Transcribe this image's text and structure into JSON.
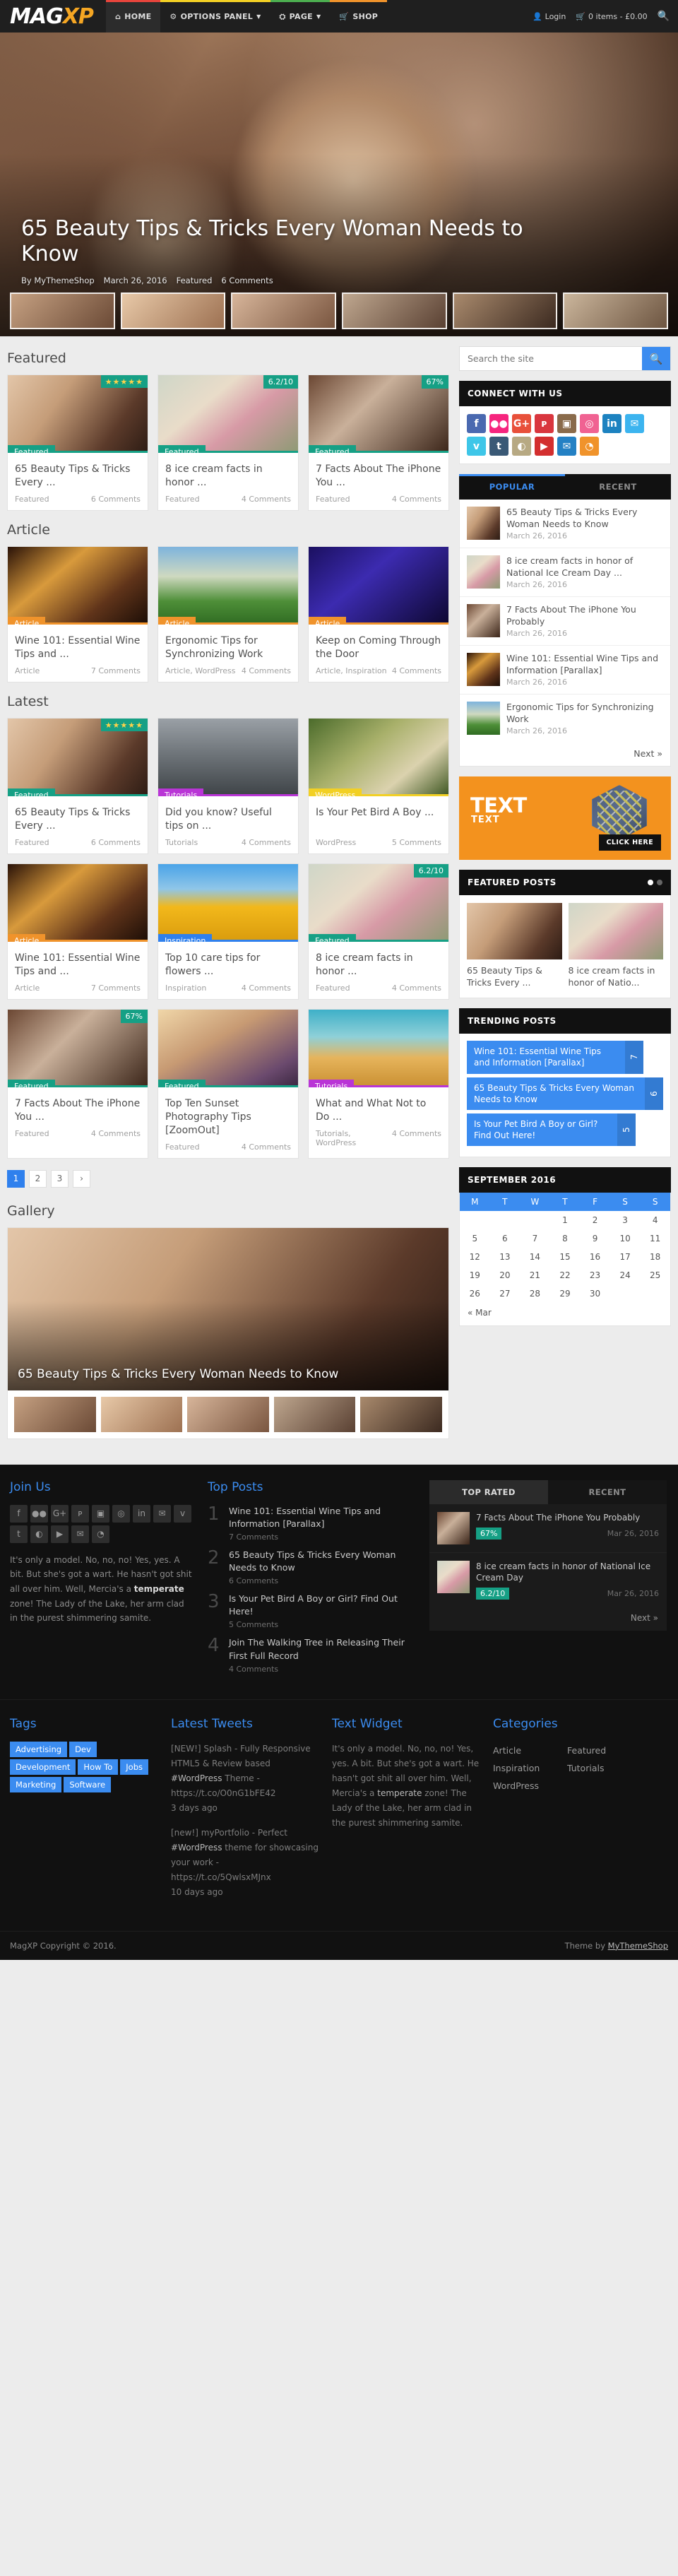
{
  "header": {
    "logo_main": "MAG",
    "logo_accent": "XP",
    "nav": [
      {
        "label": "HOME",
        "icon": "home-icon",
        "glyph": "⌂",
        "bar": "#e8453c",
        "caret": false
      },
      {
        "label": "OPTIONS PANEL",
        "icon": "gear-icon",
        "glyph": "⚙",
        "bar": "#f2d024",
        "caret": true
      },
      {
        "label": "PAGE",
        "icon": "sitemap-icon",
        "glyph": "⛭",
        "bar": "#4caf50",
        "caret": true
      },
      {
        "label": "SHOP",
        "icon": "cart-icon",
        "glyph": "🛒",
        "bar": "#f0932b",
        "caret": false
      }
    ],
    "login": "Login",
    "login_icon": "user-icon",
    "cart": "0 items - £0.00",
    "cart_icon": "cart-icon",
    "search_icon": "search-icon"
  },
  "hero": {
    "title": "65 Beauty Tips & Tricks Every Woman Needs to Know",
    "author": "By MyThemeShop",
    "date": "March 26, 2016",
    "category": "Featured",
    "comments": "6 Comments"
  },
  "sections": {
    "featured_title": "Featured",
    "article_title": "Article",
    "latest_title": "Latest",
    "gallery_title": "Gallery"
  },
  "featured_cards": [
    {
      "title": "65 Beauty Tips & Tricks Every ...",
      "label": "Featured",
      "cat": "Featured",
      "comments": "6 Comments",
      "badge": "★★★★★",
      "badge_type": "stars",
      "img": "img-beauty",
      "color": "teal"
    },
    {
      "title": "8 ice cream facts in honor ...",
      "label": "Featured",
      "cat": "Featured",
      "comments": "4 Comments",
      "badge": "6.2/10",
      "badge_type": "score",
      "img": "img-ice",
      "color": "teal"
    },
    {
      "title": "7 Facts About The iPhone You ...",
      "label": "Featured",
      "cat": "Featured",
      "comments": "4 Comments",
      "badge": "67%",
      "badge_type": "score",
      "img": "img-phone",
      "color": "teal"
    }
  ],
  "article_cards": [
    {
      "title": "Wine 101: Essential Wine Tips and ...",
      "label": "Article",
      "cat": "Article",
      "comments": "7 Comments",
      "badge": "",
      "badge_type": "none",
      "img": "img-wine",
      "color": "orange"
    },
    {
      "title": "Ergonomic Tips for Synchronizing Work",
      "label": "Article",
      "cat": "Article, WordPress",
      "comments": "4 Comments",
      "badge": "",
      "badge_type": "none",
      "img": "img-chairs",
      "color": "orange"
    },
    {
      "title": "Keep on Coming Through the Door",
      "label": "Article",
      "cat": "Article, Inspiration",
      "comments": "4 Comments",
      "badge": "",
      "badge_type": "none",
      "img": "img-dj",
      "color": "orange"
    }
  ],
  "latest_cards": [
    {
      "title": "65 Beauty Tips & Tricks Every ...",
      "label": "Featured",
      "cat": "Featured",
      "comments": "6 Comments",
      "badge": "★★★★★",
      "badge_type": "stars",
      "img": "img-beauty",
      "color": "teal"
    },
    {
      "title": "Did you know? Useful tips on ...",
      "label": "Tutorials",
      "cat": "Tutorials",
      "comments": "4 Comments",
      "badge": "",
      "badge_type": "none",
      "img": "img-street",
      "color": "purple"
    },
    {
      "title": "Is Your Pet Bird A Boy ...",
      "label": "WordPress",
      "cat": "WordPress",
      "comments": "5 Comments",
      "badge": "",
      "badge_type": "none",
      "img": "img-bird",
      "color": "yellow"
    },
    {
      "title": "Wine 101: Essential Wine Tips and ...",
      "label": "Article",
      "cat": "Article",
      "comments": "7 Comments",
      "badge": "",
      "badge_type": "none",
      "img": "img-wine",
      "color": "orange"
    },
    {
      "title": "Top 10 care tips for flowers ...",
      "label": "Inspiration",
      "cat": "Inspiration",
      "comments": "4 Comments",
      "badge": "",
      "badge_type": "none",
      "img": "img-sun",
      "color": "blue"
    },
    {
      "title": "8 ice cream facts in honor ...",
      "label": "Featured",
      "cat": "Featured",
      "comments": "4 Comments",
      "badge": "6.2/10",
      "badge_type": "score",
      "img": "img-ice",
      "color": "teal"
    },
    {
      "title": "7 Facts About The iPhone You ...",
      "label": "Featured",
      "cat": "Featured",
      "comments": "4 Comments",
      "badge": "67%",
      "badge_type": "score",
      "img": "img-phone",
      "color": "teal"
    },
    {
      "title": "Top Ten Sunset Photography Tips [ZoomOut]",
      "label": "Featured",
      "cat": "Featured",
      "comments": "4 Comments",
      "badge": "",
      "badge_type": "none",
      "img": "img-sunset",
      "color": "teal"
    },
    {
      "title": "What and What Not to Do ...",
      "label": "Tutorials",
      "cat": "Tutorials, WordPress",
      "comments": "4 Comments",
      "badge": "",
      "badge_type": "none",
      "img": "img-wheat",
      "color": "purple"
    }
  ],
  "pagination": {
    "pages": [
      "1",
      "2",
      "3"
    ],
    "next": "›",
    "current": "1"
  },
  "gallery": {
    "title": "65 Beauty Tips & Tricks Every Woman Needs to Know"
  },
  "sidebar": {
    "search_placeholder": "Search the site",
    "search_icon": "search-icon",
    "connect_title": "CONNECT WITH US",
    "socials": [
      {
        "name": "facebook-icon",
        "glyph": "f",
        "color": "#4a69b0"
      },
      {
        "name": "flickr-icon",
        "glyph": "●●",
        "color": "#f6257e"
      },
      {
        "name": "googleplus-icon",
        "glyph": "G+",
        "color": "#e8503a"
      },
      {
        "name": "pinterest-icon",
        "glyph": "ᴘ",
        "color": "#d9363e"
      },
      {
        "name": "instagram-icon",
        "glyph": "▣",
        "color": "#8a6b4b"
      },
      {
        "name": "dribbble-icon",
        "glyph": "◎",
        "color": "#f06292"
      },
      {
        "name": "linkedin-icon",
        "glyph": "in",
        "color": "#1c82c0"
      },
      {
        "name": "twitter-icon",
        "glyph": "✉",
        "color": "#3cb4ef"
      },
      {
        "name": "vimeo-icon",
        "glyph": "v",
        "color": "#3ec6e8"
      },
      {
        "name": "tumblr-icon",
        "glyph": "t",
        "color": "#3a5976"
      },
      {
        "name": "github-icon",
        "glyph": "◐",
        "color": "#b7a983"
      },
      {
        "name": "youtube-icon",
        "glyph": "▶",
        "color": "#d32f2f"
      },
      {
        "name": "email-icon",
        "glyph": "✉",
        "color": "#2481c4"
      },
      {
        "name": "rss-icon",
        "glyph": "◔",
        "color": "#f0932b"
      }
    ],
    "tabs": {
      "popular": "POPULAR",
      "recent": "RECENT",
      "active": "POPULAR"
    },
    "popular_posts": [
      {
        "title": "65 Beauty Tips & Tricks Every Woman Needs to Know",
        "date": "March 26, 2016",
        "img": "img-beauty"
      },
      {
        "title": "8 ice cream facts in honor of National Ice Cream Day ...",
        "date": "March 26, 2016",
        "img": "img-ice"
      },
      {
        "title": "7 Facts About The iPhone You Probably",
        "date": "March 26, 2016",
        "img": "img-phone"
      },
      {
        "title": "Wine 101: Essential Wine Tips and Information [Parallax]",
        "date": "March 26, 2016",
        "img": "img-wine"
      },
      {
        "title": "Ergonomic Tips for Synchronizing Work",
        "date": "March 26, 2016",
        "img": "img-chairs"
      }
    ],
    "next_label": "Next »",
    "ad": {
      "line1": "TEXT",
      "line2": "TEXT",
      "cta": "CLICK HERE"
    },
    "featured_posts_title": "FEATURED POSTS",
    "featured_posts": [
      {
        "title": "65 Beauty Tips & Tricks Every ...",
        "img": "img-beauty"
      },
      {
        "title": "8 ice cream facts in honor of Natio...",
        "img": "img-ice"
      }
    ],
    "trending_title": "TRENDING POSTS",
    "trending": [
      {
        "title": "Wine 101: Essential Wine Tips and Information [Parallax]",
        "count": "7",
        "width": "90%"
      },
      {
        "title": "65 Beauty Tips & Tricks Every Woman Needs to Know",
        "count": "6",
        "width": "100%"
      },
      {
        "title": "Is Your Pet Bird A Boy or Girl? Find Out Here!",
        "count": "5",
        "width": "86%"
      }
    ],
    "calendar": {
      "title": "SEPTEMBER 2016",
      "weekdays": [
        "M",
        "T",
        "W",
        "T",
        "F",
        "S",
        "S"
      ],
      "weeks": [
        [
          "",
          "",
          "",
          "1",
          "2",
          "3",
          "4"
        ],
        [
          "5",
          "6",
          "7",
          "8",
          "9",
          "10",
          "11"
        ],
        [
          "12",
          "13",
          "14",
          "15",
          "16",
          "17",
          "18"
        ],
        [
          "19",
          "20",
          "21",
          "22",
          "23",
          "24",
          "25"
        ],
        [
          "26",
          "27",
          "28",
          "29",
          "30",
          "",
          ""
        ]
      ],
      "prev": "« Mar"
    }
  },
  "footer_top": {
    "join_title": "Join Us",
    "join_text_1": "It's only a model. No, no, no! Yes, yes. A bit. But she's got a wart. He hasn't got shit all over him. Well, Mercia's a ",
    "join_text_bold": "temperate",
    "join_text_2": " zone! The Lady of the Lake, her arm clad in the purest shimmering samite.",
    "top_posts_title": "Top Posts",
    "top_posts": [
      {
        "n": "1",
        "title": "Wine 101: Essential Wine Tips and Information [Parallax]",
        "comments": "7 Comments"
      },
      {
        "n": "2",
        "title": "65 Beauty Tips & Tricks Every Woman Needs to Know",
        "comments": "6 Comments"
      },
      {
        "n": "3",
        "title": "Is Your Pet Bird A Boy or Girl? Find Out Here!",
        "comments": "5 Comments"
      },
      {
        "n": "4",
        "title": "Join The Walking Tree in Releasing Their First Full Record",
        "comments": "4 Comments"
      }
    ],
    "rated_tabs": {
      "top": "TOP RATED",
      "recent": "RECENT",
      "active": "TOP RATED"
    },
    "rated": [
      {
        "title": "7 Facts About The iPhone You Probably",
        "score": "67%",
        "date": "Mar 26, 2016",
        "img": "img-phone"
      },
      {
        "title": "8 ice cream facts in honor of National Ice Cream Day",
        "score": "6.2/10",
        "date": "Mar 26, 2016",
        "img": "img-ice"
      }
    ],
    "rated_next": "Next »"
  },
  "footer_bottom": {
    "tags_title": "Tags",
    "tags": [
      "Advertising",
      "Dev",
      "Development",
      "How To",
      "Jobs",
      "Marketing",
      "Software"
    ],
    "tweets_title": "Latest Tweets",
    "tweets": [
      {
        "pre": "[NEW!] Splash - Fully Responsive HTML5 & Review based ",
        "hash": "#WordPress",
        "post": " Theme - https://t.co/O0nG1bFE42",
        "ago": "3 days ago"
      },
      {
        "pre": "[new!] myPortfolio - Perfect ",
        "hash": "#WordPress",
        "post": " theme for showcasing your work - https://t.co/5QwlsxMJnx",
        "ago": "10 days ago"
      }
    ],
    "text_widget_title": "Text Widget",
    "text_widget_1": "It's only a model. No, no, no! Yes, yes. A bit. But she's got a wart. He hasn't got shit all over him. Well, Mercia's a ",
    "text_widget_bold": "temperate",
    "text_widget_2": " zone! The Lady of the Lake, her arm clad in the purest shimmering samite.",
    "categories_title": "Categories",
    "categories": [
      "Article",
      "Featured",
      "Inspiration",
      "Tutorials",
      "WordPress"
    ],
    "copyright": "MagXP Copyright © 2016.",
    "theme_by": "Theme by ",
    "theme_link": "MyThemeShop"
  }
}
